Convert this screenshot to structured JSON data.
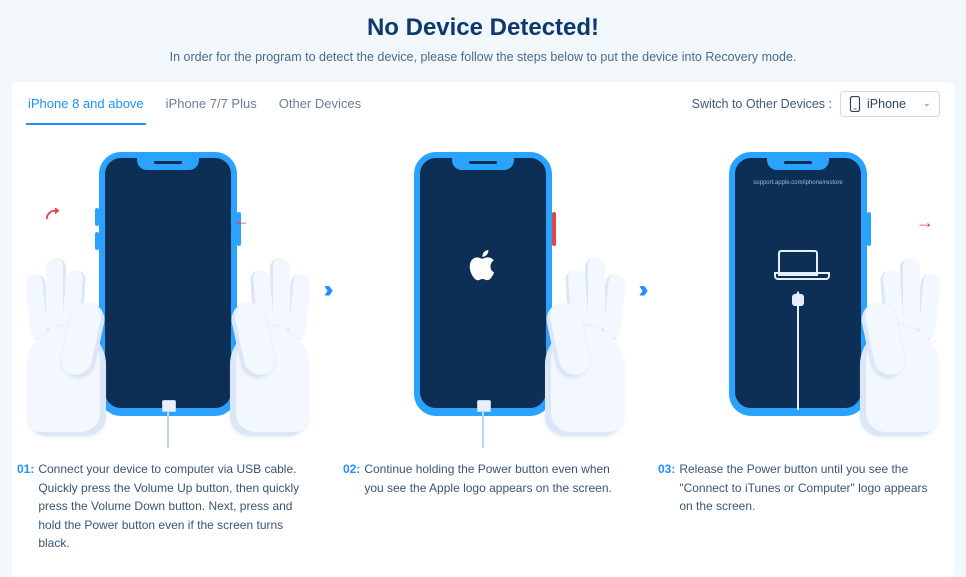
{
  "header": {
    "title": "No Device Detected!",
    "subtitle": "In order for the program to detect the device, please follow the steps below to put the device into Recovery mode."
  },
  "tabs": [
    {
      "label": "iPhone 8 and above",
      "active": true
    },
    {
      "label": "iPhone 7/7 Plus",
      "active": false
    },
    {
      "label": "Other Devices",
      "active": false
    }
  ],
  "switcher": {
    "label": "Switch to Other Devices :",
    "selected": "iPhone"
  },
  "steps": [
    {
      "num": "01:",
      "desc": "Connect your device to computer via USB cable. Quickly press the Volume Up button, then quickly press the Volume Down button. Next, press and hold the Power button even if the screen turns black."
    },
    {
      "num": "02:",
      "desc": "Continue holding the Power button even when you see the Apple logo appears on the screen."
    },
    {
      "num": "03:",
      "desc": "Release the Power button until you see the \"Connect to iTunes or Computer\" logo appears on the screen."
    }
  ],
  "recovery_url": "support.apple.com/iphone/restore"
}
